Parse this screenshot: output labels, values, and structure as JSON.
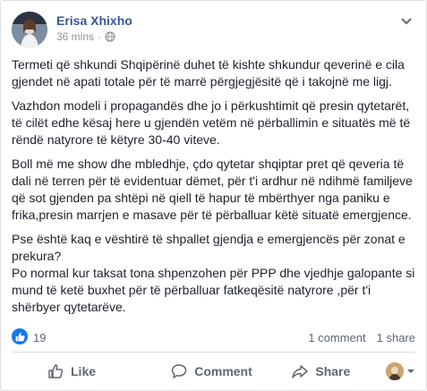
{
  "post": {
    "author": "Erisa Xhixho",
    "time": "36 mins",
    "dot": "·",
    "paragraphs": [
      "Termeti që shkundi Shqipërinë duhet të kishte shkundur qeverinë e cila gjendet në apati totale për të marrë përgjegjësitë që i takojnë me ligj.",
      "Vazhdon modeli i propagandës dhe jo i përkushtimit që presin qytetarët, të cilët edhe kësaj here u gjendën vetëm në përballimin e situatës më të rëndë natyrore të këtyre 30-40 viteve.",
      "Boll më me show dhe mbledhje, çdo qytetar shqiptar pret që qeveria të dali në terren për të evidentuar dëmet, për t'i ardhur në ndihmë familjeve që sot gjenden pa shtëpi në qiell të hapur të mbërthyer nga paniku e frika,presin marrjen e masave për të përballuar këtë situatë emergjence.",
      "Pse është kaq e vështirë të shpallet gjendja e emergjencës për zonat e prekura?",
      "Po normal kur taksat tona shpenzohen për PPP dhe vjedhje galopante si mund të ketë buxhet për të përballuar fatkeqësitë natyrore ,për t'i shërbyer qytetarëve."
    ]
  },
  "reactions": {
    "count": "19",
    "comments": "1 comment",
    "shares": "1 share"
  },
  "actions": {
    "like": "Like",
    "comment": "Comment",
    "share": "Share"
  },
  "icons": {
    "privacy": "globe-icon",
    "options": "chevron-down-icon",
    "reaction": "like-reaction-icon",
    "like": "thumbs-up-icon",
    "comment": "speech-bubble-icon",
    "share": "share-arrow-icon"
  },
  "colors": {
    "author": "#365899",
    "meta": "#90949c",
    "action": "#606770",
    "like_blue": "#1877f2"
  }
}
